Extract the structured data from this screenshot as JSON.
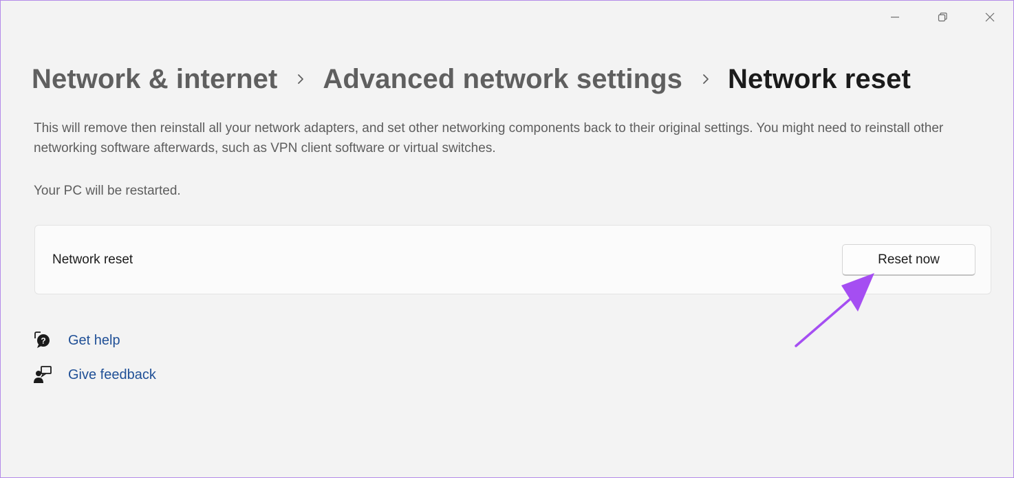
{
  "window_controls": {
    "minimize_icon": "minimize-icon",
    "maximize_icon": "restore-icon",
    "close_icon": "close-icon"
  },
  "breadcrumb": {
    "items": [
      {
        "label": "Network & internet"
      },
      {
        "label": "Advanced network settings"
      },
      {
        "label": "Network reset"
      }
    ],
    "separator_icon": "chevron-right-icon"
  },
  "description": "This will remove then reinstall all your network adapters, and set other networking components back to their original settings. You might need to reinstall other networking software afterwards, such as VPN client software or virtual switches.",
  "restart_note": "Your PC will be restarted.",
  "reset_card": {
    "label": "Network reset",
    "button_label": "Reset now"
  },
  "help_links": {
    "get_help": "Get help",
    "give_feedback": "Give feedback"
  },
  "colors": {
    "background": "#f3f3f3",
    "link": "#1f4f96",
    "annotation_arrow": "#a54ef2",
    "window_border": "#b48be8"
  }
}
